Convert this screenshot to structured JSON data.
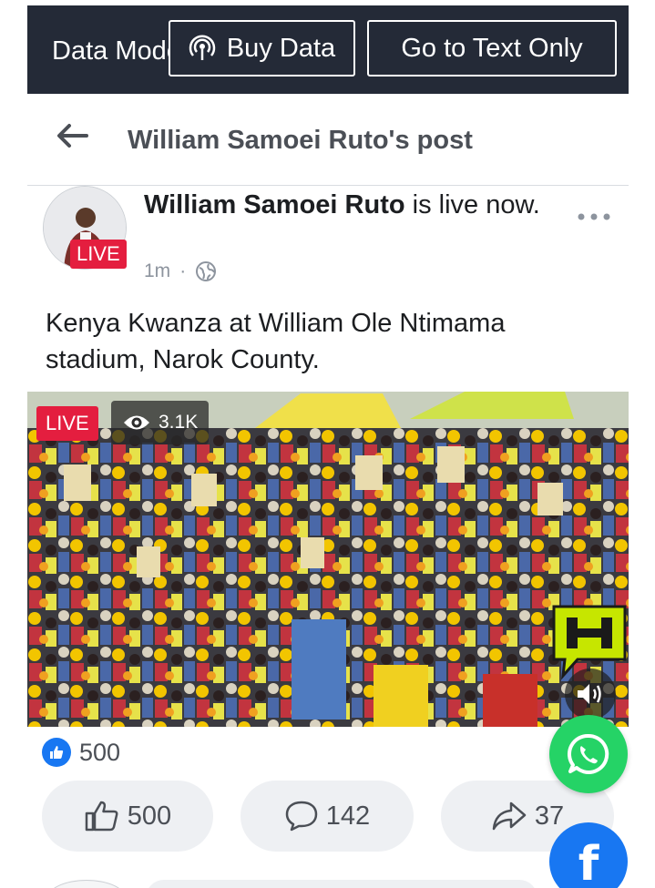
{
  "topbar": {
    "data_mode_label": "Data Mode",
    "buy_data_label": "Buy Data",
    "text_only_label": "Go to Text Only"
  },
  "header": {
    "title": "William Samoei Ruto's post"
  },
  "post": {
    "author_name": "William Samoei Ruto",
    "status_text": " is live now.",
    "avatar_badge": "LIVE",
    "time": "1m",
    "dot": "·",
    "audience_icon": "globe-icon",
    "caption": "Kenya Kwanza at William Ole Ntimama stadium, Narok County."
  },
  "video": {
    "live_label": "LIVE",
    "views": "3.1K"
  },
  "reactions": {
    "count": "500"
  },
  "actions": {
    "like_count": "500",
    "comment_count": "142",
    "share_count": "37"
  },
  "colors": {
    "topbar_bg": "#242a37",
    "live_red": "#e41e3f",
    "facebook_blue": "#1877f2",
    "whatsapp_green": "#25d366"
  }
}
